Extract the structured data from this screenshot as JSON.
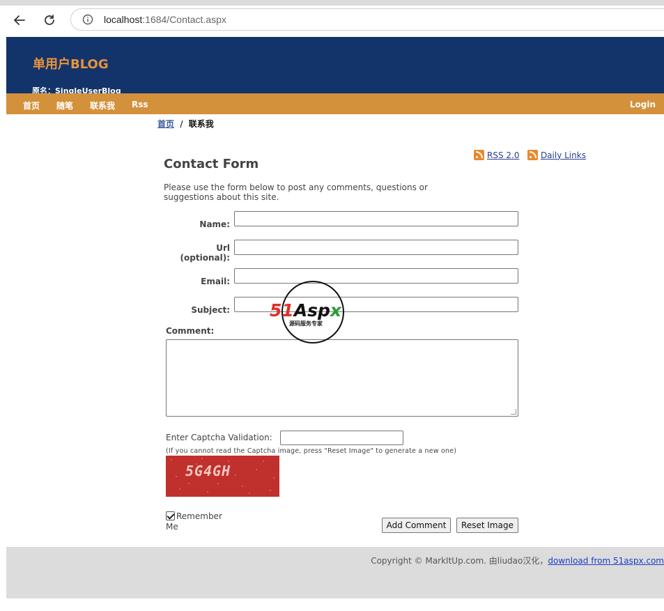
{
  "browser": {
    "address_host": "localhost",
    "address_rest": ":1684/Contact.aspx"
  },
  "site": {
    "title": "单用户BLOG",
    "subtitle": "原名：SingleUserBlog"
  },
  "nav": {
    "items": [
      "首页",
      "随笔",
      "联系我",
      "Rss"
    ],
    "login": "Login"
  },
  "breadcrumb": {
    "home": "首页",
    "separator": "/",
    "current": "联系我"
  },
  "feeds": {
    "rss": " RSS 2.0",
    "daily": " Daily Links"
  },
  "form": {
    "title": "Contact Form",
    "intro": "Please use the form below to post any comments, questions or suggestions about this site.",
    "name_label": "Name:",
    "url_label_1": "Url",
    "url_label_2": "(optional):",
    "email_label": "Email:",
    "subject_label": "Subject:",
    "comment_label": "Comment:",
    "captcha_label": "Enter Captcha Validation:",
    "captcha_note": "(If you cannot read the Captcha image, press \"Reset Image\" to generate a new one)",
    "captcha_code": "5G4GH",
    "remember_label": "Remember Me",
    "remember_checked": true,
    "add_button": "Add Comment",
    "reset_button": "Reset Image"
  },
  "footer": {
    "text": "Copyright © MarkItUp.com.  由liudao汉化，",
    "link": "download from 51aspx.com"
  },
  "watermark": {
    "part1": "51",
    "part2": "Asp",
    "part3": "x",
    "sub": "源码服务专家"
  },
  "colors": {
    "header_bg": "#13336b",
    "nav_bg": "#d3913b",
    "title_accent": "#e8943a",
    "footer_bg": "#dcdcdc"
  }
}
